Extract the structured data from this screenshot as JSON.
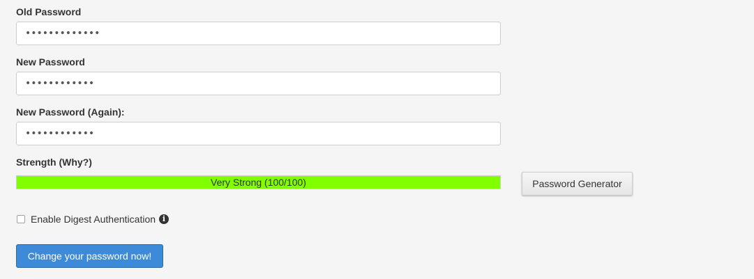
{
  "form": {
    "old_password": {
      "label": "Old Password",
      "value": "•••••••••••••"
    },
    "new_password": {
      "label": "New Password",
      "value": "••••••••••••"
    },
    "new_password_again": {
      "label": "New Password (Again):",
      "value": "••••••••••••"
    },
    "strength": {
      "label": "Strength (Why?)",
      "text": "Very Strong (100/100)",
      "level_percent": 100,
      "bar_color": "#80ff00"
    },
    "generator_button_label": "Password Generator",
    "digest": {
      "label": "Enable Digest Authentication",
      "checked": false,
      "info_icon": "info-circle-icon"
    },
    "submit_label": "Change your password now!",
    "submit_color": "#3d8bd8"
  }
}
